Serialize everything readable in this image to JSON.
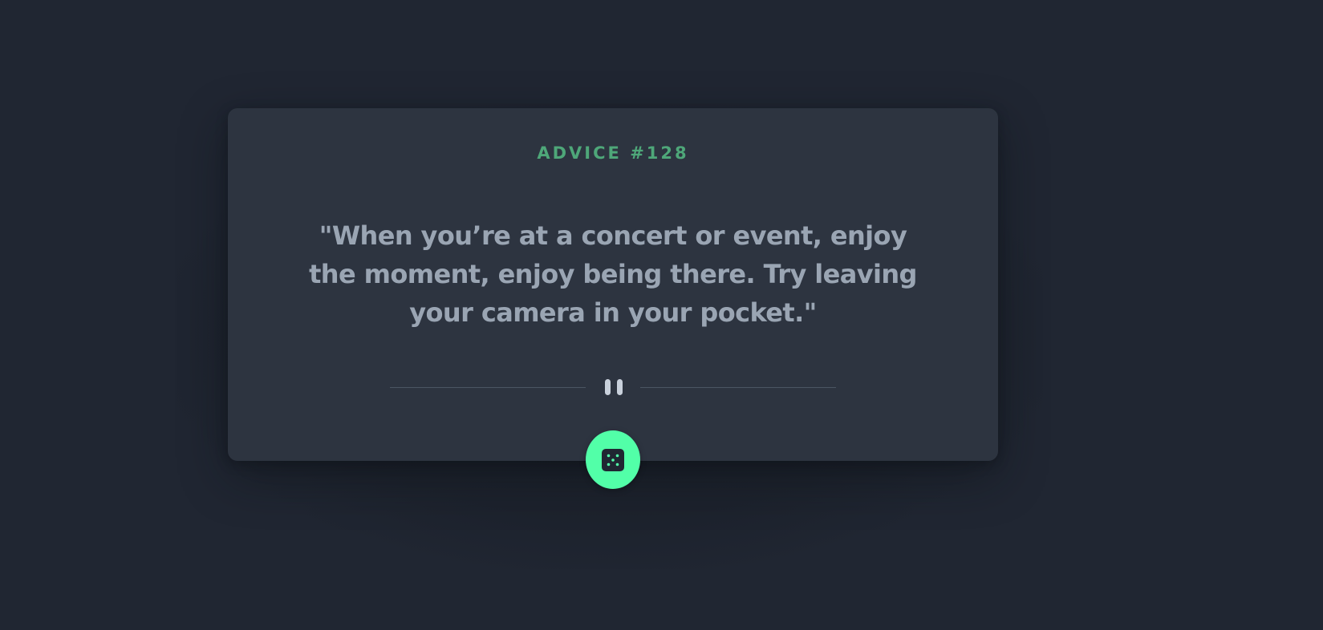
{
  "advice": {
    "id_label": "ADVICE #128",
    "quote": "\"When you’re at a concert or event, enjoy the moment, enjoy being there. Try leaving your camera in your pocket.\""
  },
  "icons": {
    "divider": "pause-icon",
    "button": "dice-icon"
  },
  "colors": {
    "background": "#202632",
    "card": "#2d3440",
    "accent_text": "#4ea779",
    "quote_text": "#9aa5b3",
    "button": "#52ffa8"
  }
}
